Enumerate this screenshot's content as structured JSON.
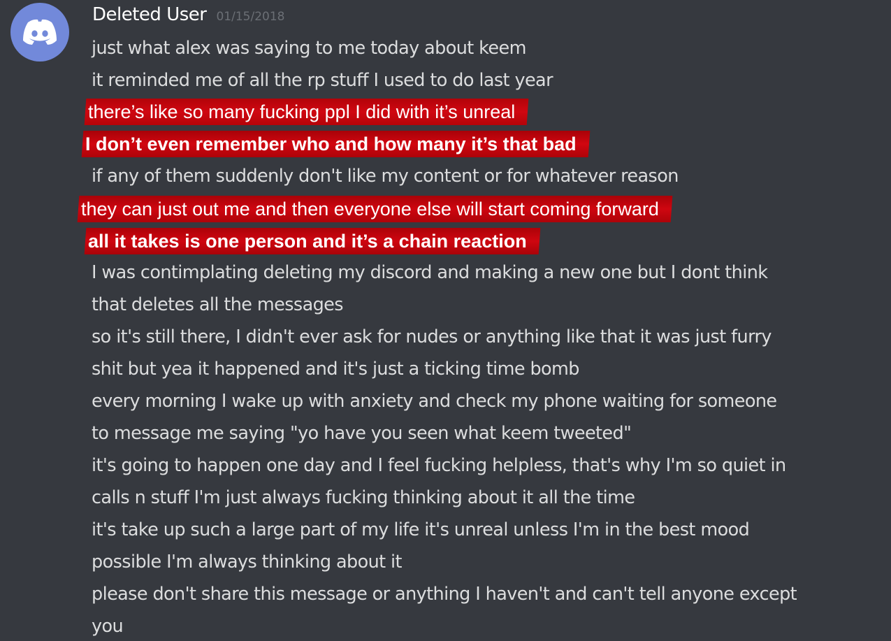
{
  "message": {
    "avatar": {
      "icon": "discord-logo-icon",
      "color": "#7289da"
    },
    "author": "Deleted User",
    "timestamp": "01/15/2018",
    "lines": [
      "just what alex was saying to me today about keem",
      "it reminded me of all the rp stuff I used to do last year",
      "there’s like so many fucking ppl I did with it’s unreal",
      "I don’t even remember who and how many it’s that bad",
      "if any of them suddenly don't like my content or for whatever reason",
      "they can just out me and then everyone else will start coming forward",
      "all it takes is one person and it’s a chain reaction",
      "I was contimplating deleting my discord and making a new one but I dont think",
      "that deletes all the messages",
      "so it's still there, I didn't ever ask for nudes or anything like that it was just furry",
      "shit but yea it happened and it's just a ticking time bomb",
      "every morning I wake up with anxiety and check my phone waiting for someone",
      "to message me saying \"yo have you seen what keem tweeted\"",
      "it's going to happen one day and I feel fucking helpless, that's why I'm so quiet in",
      "calls n stuff I'm just always fucking thinking about it all the time",
      "it's take up such a large part of my life it's unreal unless I'm in the best mood",
      "possible I'm always thinking about it",
      "please don't share this message or anything I haven't and can't tell anyone except",
      "you"
    ]
  },
  "colors": {
    "background": "#36393f",
    "text": "#dcddde",
    "username": "#ffffff",
    "timestamp": "#6b6f75",
    "highlight": "#c1040b"
  }
}
